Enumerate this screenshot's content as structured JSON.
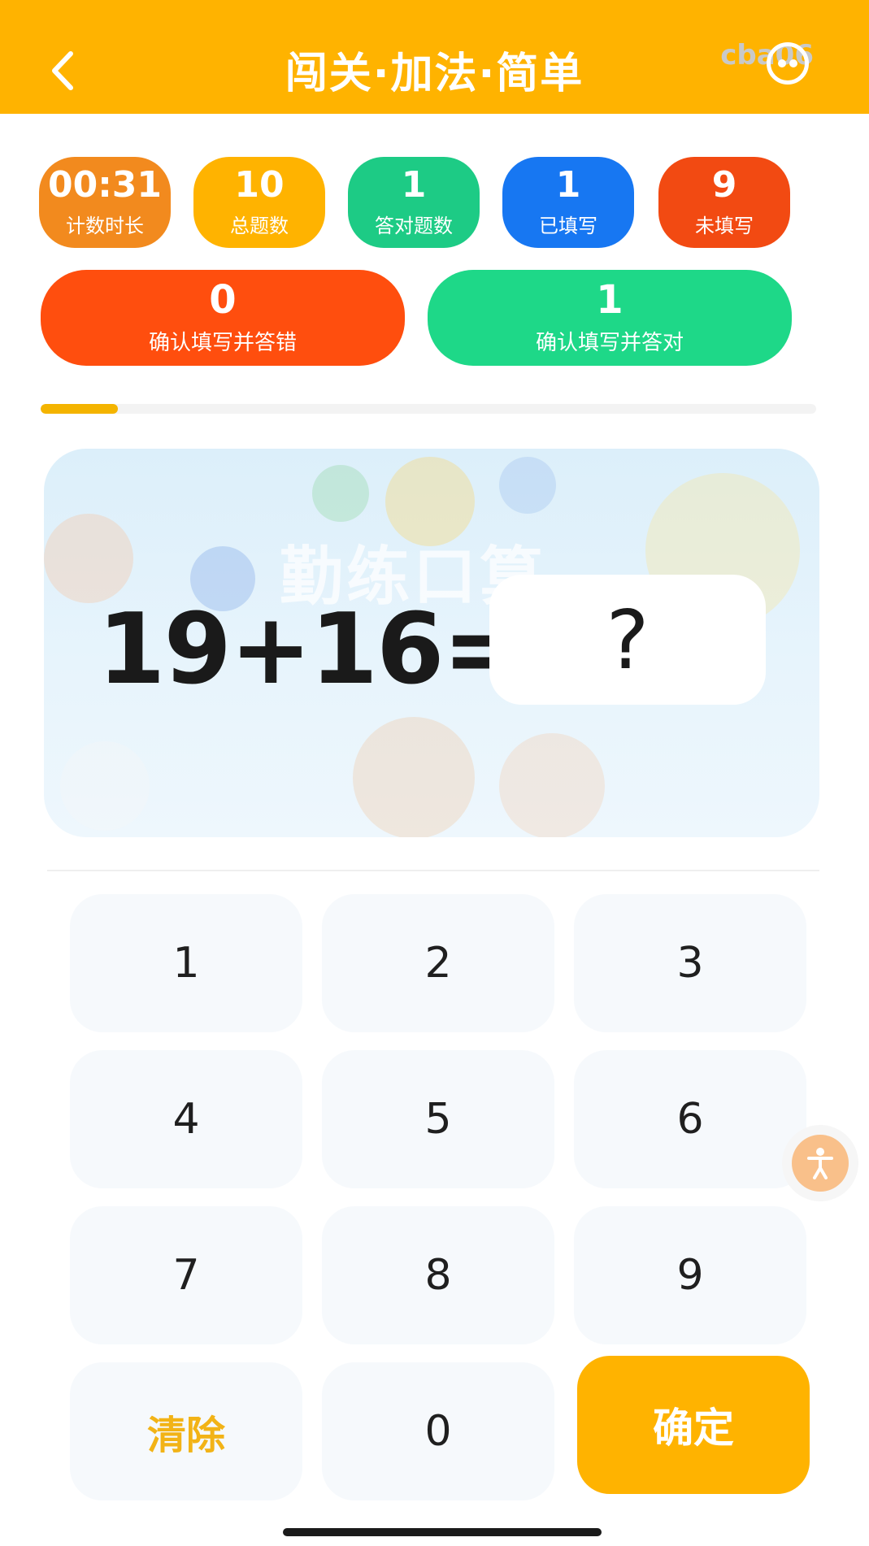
{
  "header": {
    "title": "闯关·加法·简单",
    "watermark": "cba06",
    "back_icon": "chevron-left-icon",
    "action_icon": "more-icon",
    "background": "#FFB300"
  },
  "stats": [
    {
      "value": "00:31",
      "label": "计数时长",
      "color": "#F28A1E"
    },
    {
      "value": "10",
      "label": "总题数",
      "color": "#FFB300"
    },
    {
      "value": "1",
      "label": "答对题数",
      "color": "#1DCB85"
    },
    {
      "value": "1",
      "label": "已填写",
      "color": "#1777F2"
    },
    {
      "value": "9",
      "label": "未填写",
      "color": "#F24A12"
    }
  ],
  "summary": [
    {
      "value": "0",
      "label": "确认填写并答错",
      "color": "#FF4E0E"
    },
    {
      "value": "1",
      "label": "确认填写并答对",
      "color": "#1ED888"
    }
  ],
  "progress": {
    "fraction": 0.1,
    "color": "#F4B400"
  },
  "question": {
    "expression": "19+16=",
    "answer_placeholder": "?",
    "background_text": "勤练口算"
  },
  "keypad": {
    "keys": [
      "1",
      "2",
      "3",
      "4",
      "5",
      "6",
      "7",
      "8",
      "9"
    ],
    "clear_label": "清除",
    "zero_label": "0",
    "confirm_label": "确定"
  },
  "floating_button": {
    "icon": "accessibility-icon"
  }
}
